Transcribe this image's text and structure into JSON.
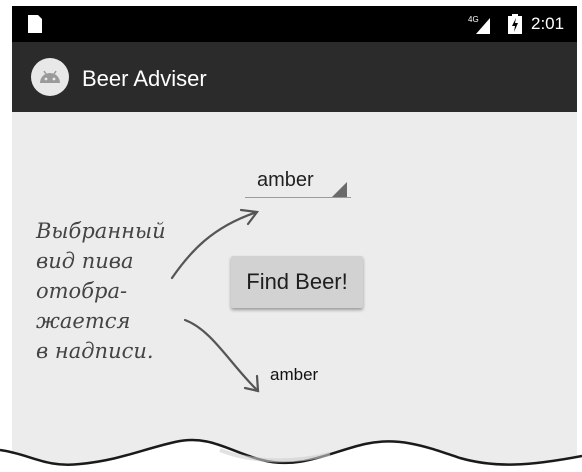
{
  "status_bar": {
    "network": "4G",
    "time": "2:01",
    "icons": [
      "sim-card-icon",
      "signal-icon",
      "battery-charging-icon"
    ]
  },
  "action_bar": {
    "app_icon": "android-icon",
    "title": "Beer Adviser"
  },
  "main": {
    "spinner": {
      "selected": "amber",
      "icon": "dropdown-triangle-icon"
    },
    "button": {
      "label": "Find Beer!"
    },
    "result": "amber"
  },
  "annotation": {
    "lines": [
      "Выбранный",
      "вид пива",
      "отобра-",
      "жается",
      "в надписи."
    ]
  },
  "colors": {
    "status_bar": "#000000",
    "action_bar": "#2b2b2b",
    "content_bg": "#ececec",
    "button_bg": "#d2d2d2",
    "annotation": "#444444"
  }
}
